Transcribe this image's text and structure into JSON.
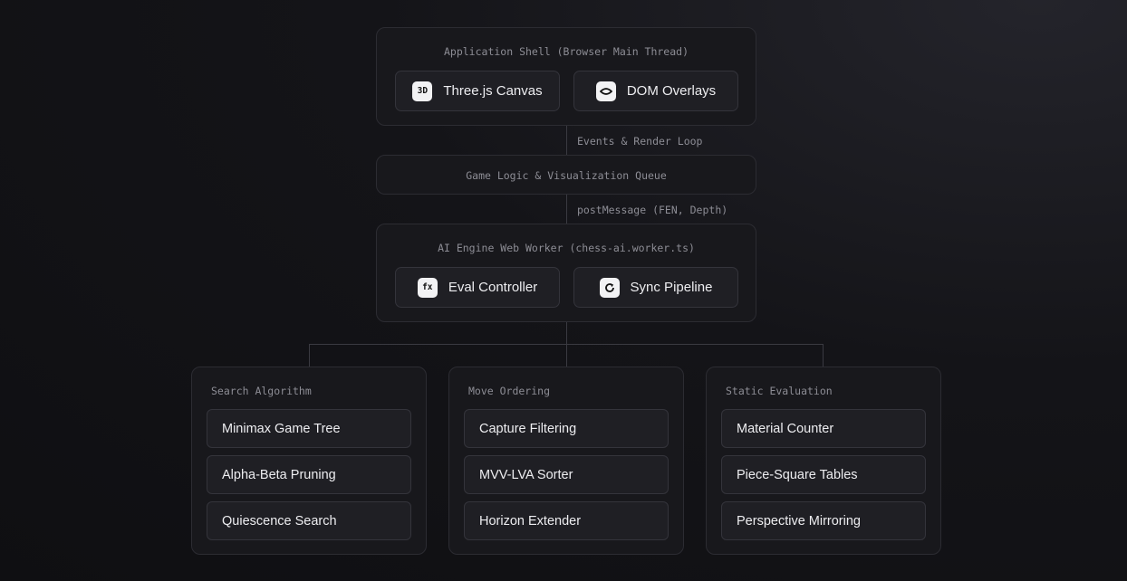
{
  "shell": {
    "title": "Application Shell (Browser Main Thread)",
    "chips": [
      {
        "icon": "3D",
        "label": "Three.js Canvas"
      },
      {
        "icon": "eye",
        "label": "DOM Overlays"
      }
    ]
  },
  "edge1": "Events & Render Loop",
  "logic": {
    "title": "Game Logic & Visualization Queue"
  },
  "edge2": "postMessage (FEN, Depth)",
  "worker": {
    "title": "AI Engine Web Worker (chess-ai.worker.ts)",
    "chips": [
      {
        "icon": "fx",
        "label": "Eval Controller"
      },
      {
        "icon": "refresh",
        "label": "Sync Pipeline"
      }
    ]
  },
  "columns": [
    {
      "title": "Search Algorithm",
      "items": [
        "Minimax Game Tree",
        "Alpha-Beta Pruning",
        "Quiescence Search"
      ]
    },
    {
      "title": "Move Ordering",
      "items": [
        "Capture Filtering",
        "MVV-LVA Sorter",
        "Horizon Extender"
      ]
    },
    {
      "title": "Static Evaluation",
      "items": [
        "Material Counter",
        "Piece-Square Tables",
        "Perspective Mirroring"
      ]
    }
  ]
}
